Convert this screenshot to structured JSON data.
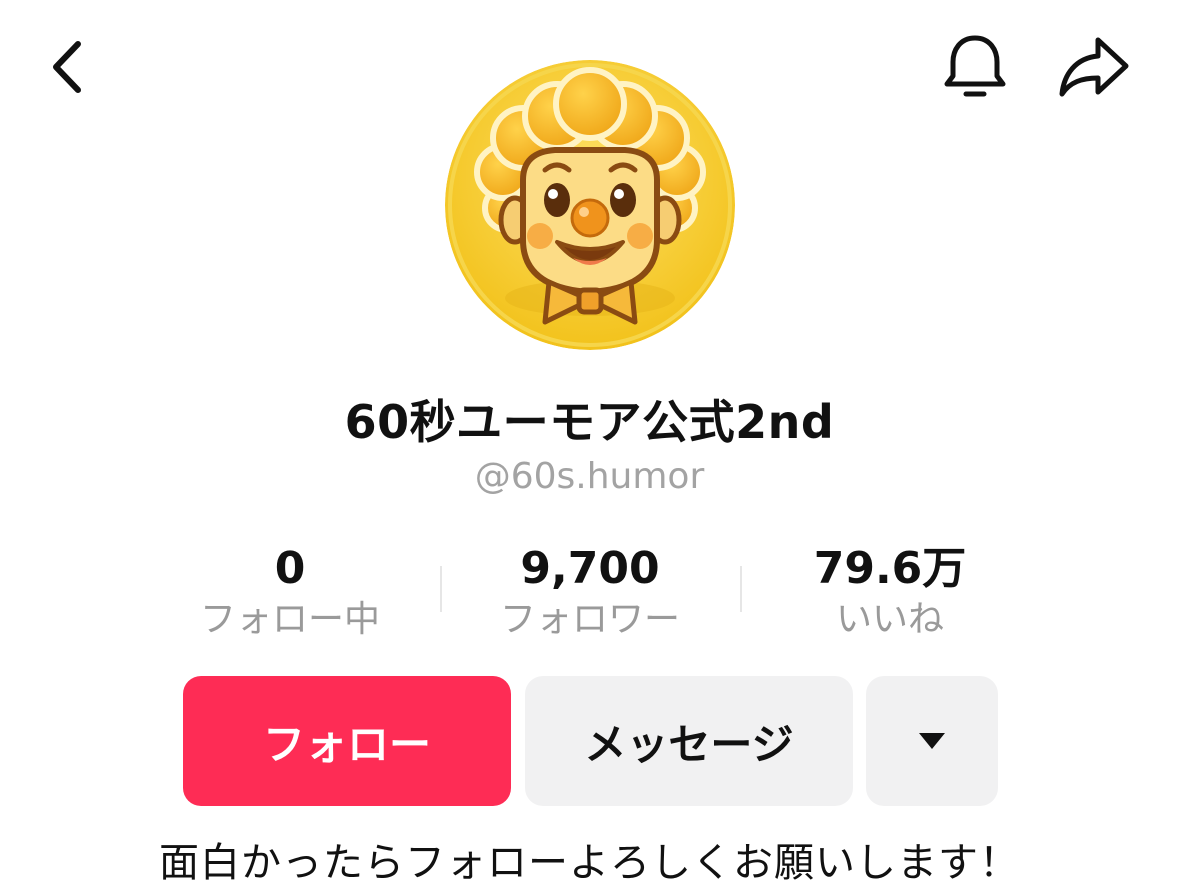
{
  "header": {
    "back_icon": "chevron-left-icon",
    "bell_icon": "bell-icon",
    "share_icon": "share-icon"
  },
  "profile": {
    "display_name": "60秒ユーモア公式2nd",
    "handle": "@60s.humor",
    "bio": "面白かったらフォローよろしくお願いします！"
  },
  "stats": [
    {
      "value": "0",
      "label": "フォロー中"
    },
    {
      "value": "9,700",
      "label": "フォロワー"
    },
    {
      "value": "79.6万",
      "label": "いいね"
    }
  ],
  "actions": {
    "follow_label": "フォロー",
    "message_label": "メッセージ",
    "more_icon": "caret-down-icon"
  },
  "colors": {
    "follow_bg": "#fe2c55",
    "secondary_bg": "#f1f1f2",
    "muted_text": "#a3a3a3"
  }
}
